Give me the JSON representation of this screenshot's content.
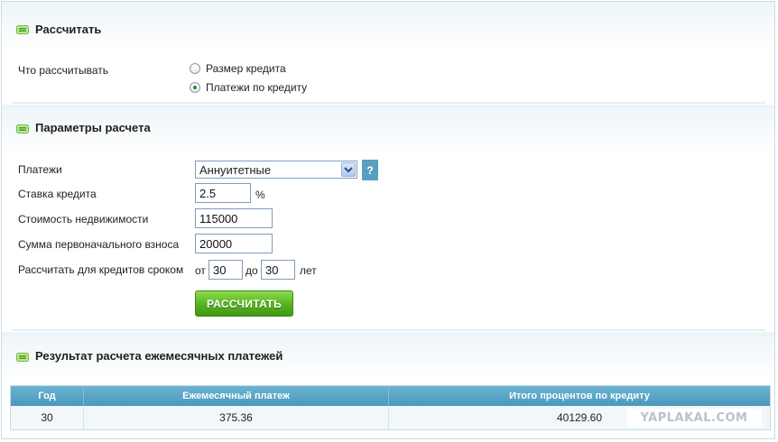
{
  "section1": {
    "title": "Рассчитать",
    "what_label": "Что рассчитывать",
    "options": [
      {
        "label": "Размер кредита",
        "checked": false
      },
      {
        "label": "Платежи по кредиту",
        "checked": true
      }
    ]
  },
  "section2": {
    "title": "Параметры расчета",
    "payments_label": "Платежи",
    "payments_value": "Аннуитетные",
    "help_label": "?",
    "rate_label": "Ставка кредита",
    "rate_value": "2.5",
    "rate_unit": "%",
    "property_label": "Стоимость недвижимости",
    "property_value": "115000",
    "down_label": "Сумма первоначального взноса",
    "down_value": "20000",
    "term_label": "Рассчитать для кредитов сроком",
    "term_from_label": "от",
    "term_from_value": "30",
    "term_to_label": "до",
    "term_to_value": "30",
    "term_unit": "лет",
    "calc_button": "РАССЧИТАТЬ"
  },
  "section3": {
    "title": "Результат расчета ежемесячных платежей",
    "columns": [
      "Год",
      "Ежемесячный платеж",
      "Итого процентов по кредиту"
    ],
    "rows": [
      [
        "30",
        "375.36",
        "40129.60"
      ]
    ]
  },
  "watermark": "YAPLAKAL.COM",
  "colors": {
    "accent": "#4a98bd",
    "button_green": "#59b522",
    "icon_green": "#6fbf3a"
  }
}
